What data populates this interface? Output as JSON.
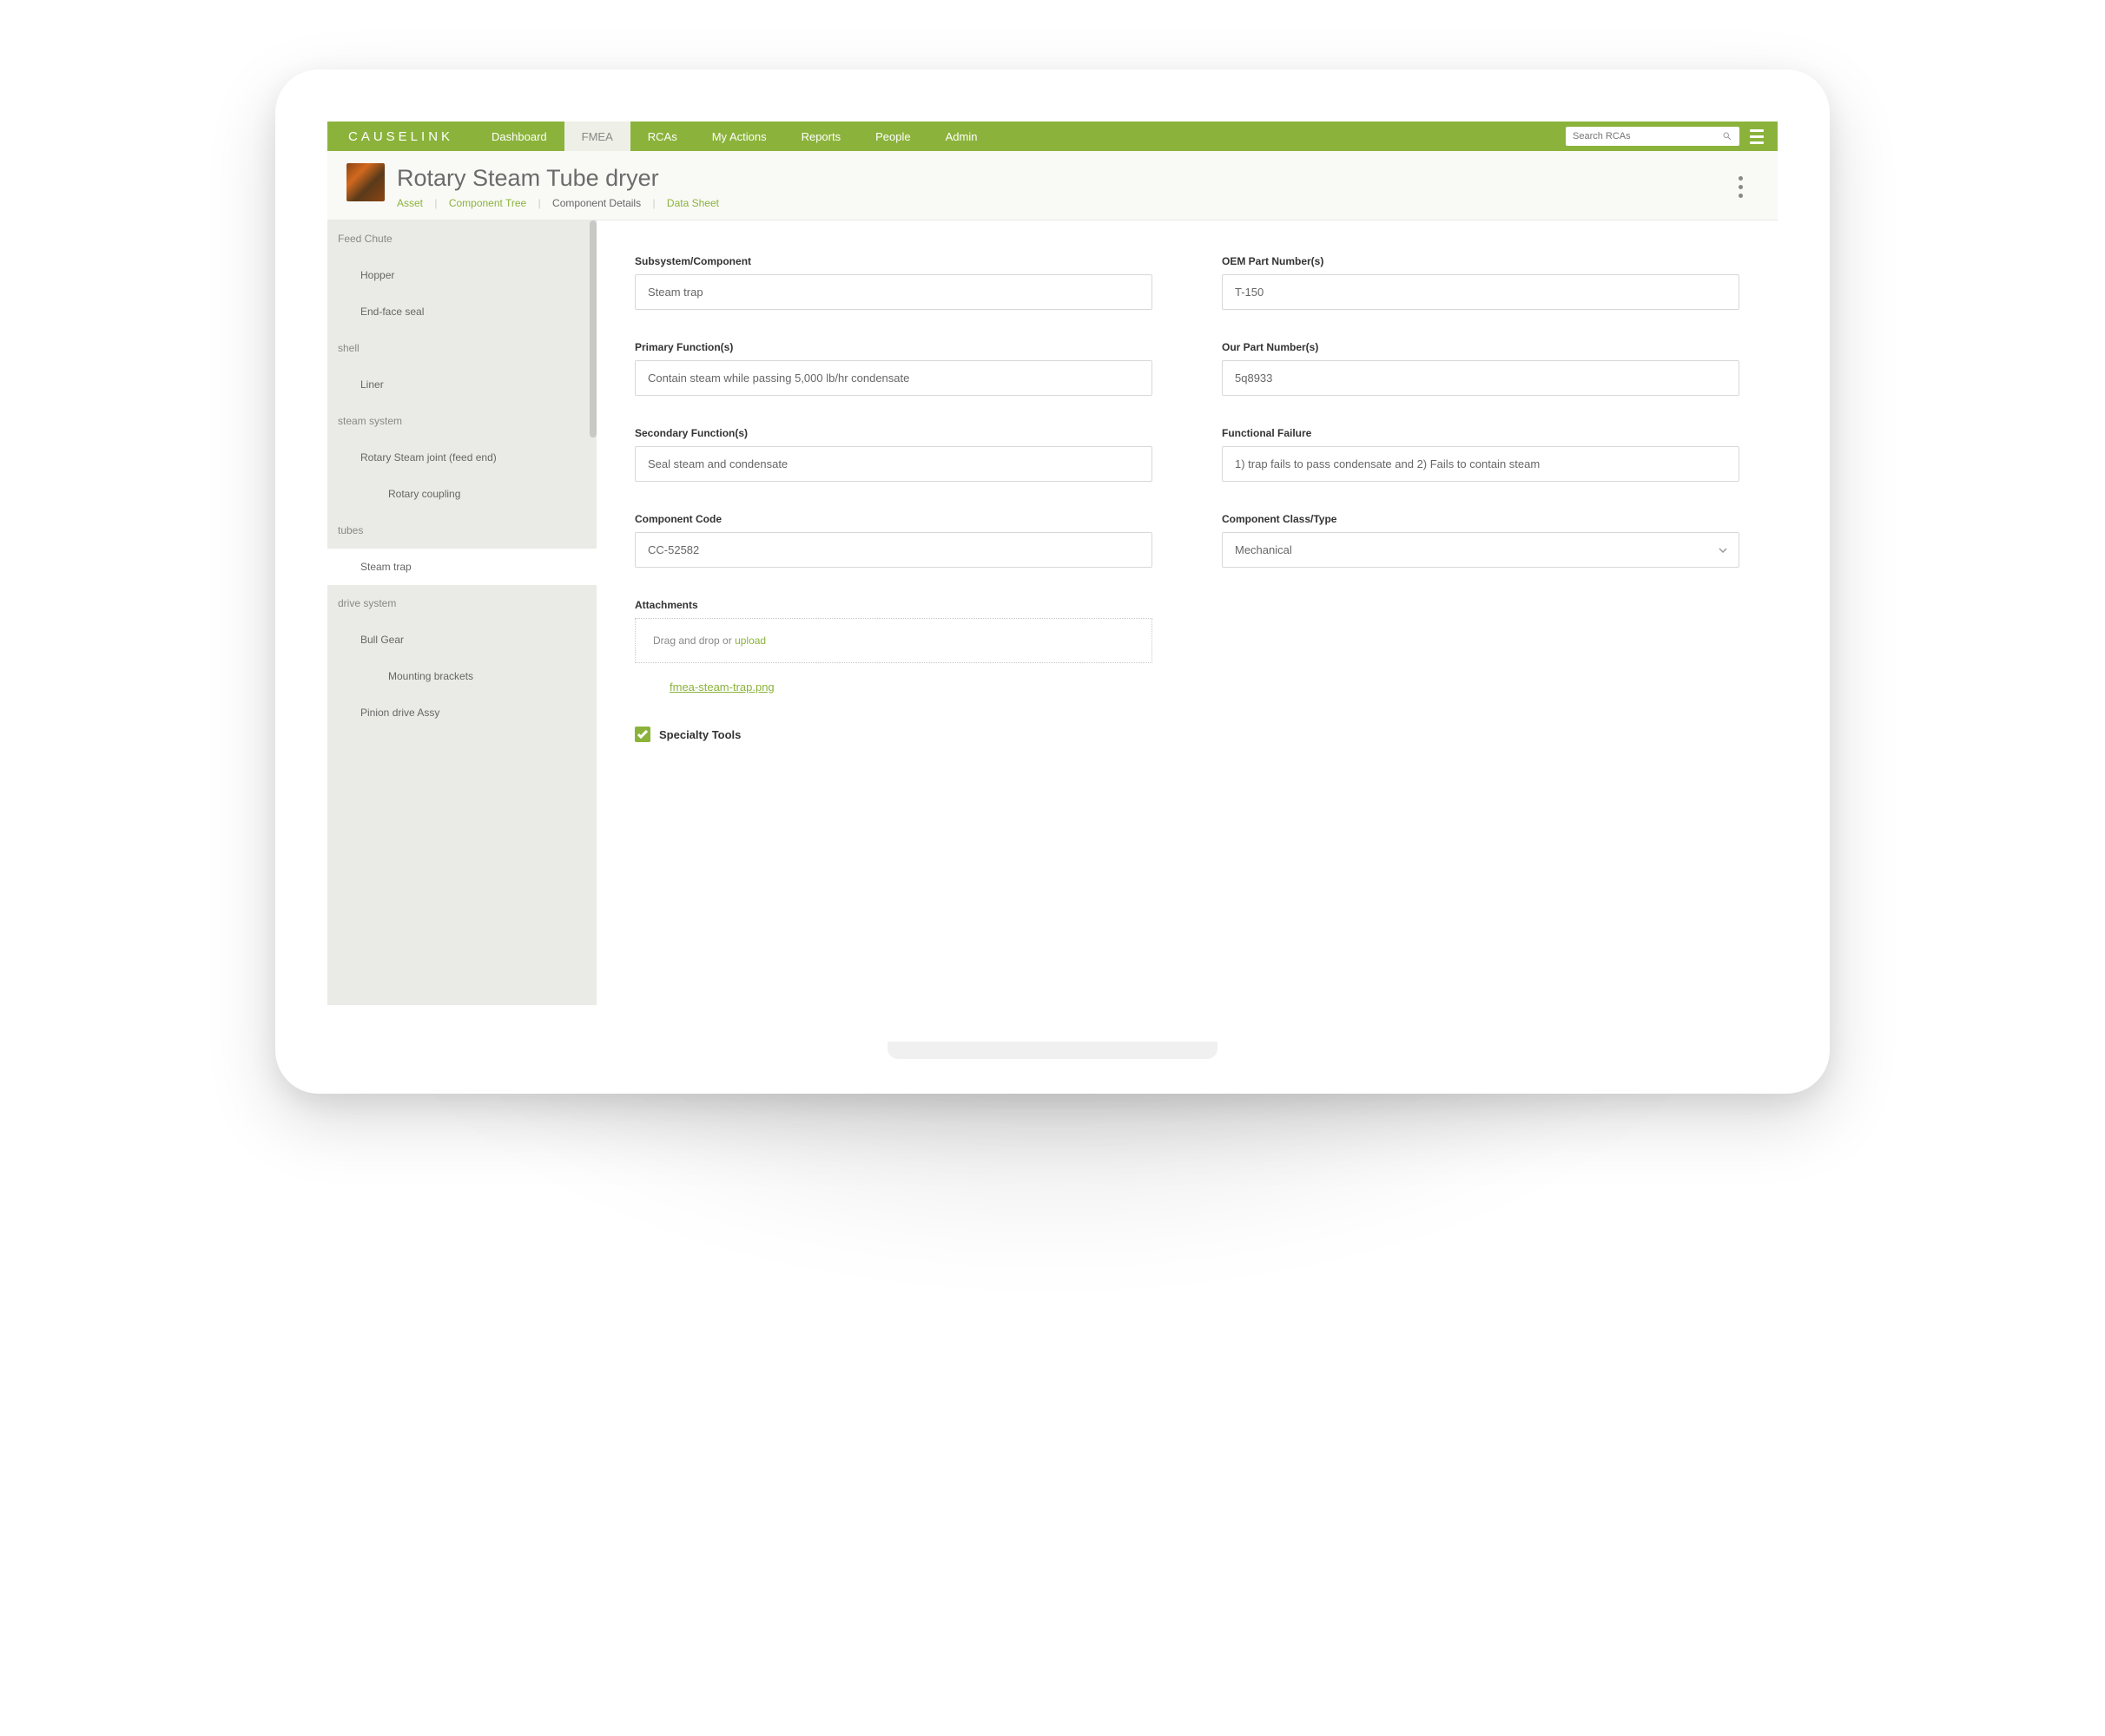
{
  "brand": "CAUSELINK",
  "nav": {
    "items": [
      "Dashboard",
      "FMEA",
      "RCAs",
      "My Actions",
      "Reports",
      "People",
      "Admin"
    ],
    "active_index": 1,
    "search_placeholder": "Search RCAs"
  },
  "header": {
    "title": "Rotary Steam Tube dryer",
    "breadcrumbs": {
      "asset": "Asset",
      "component_tree": "Component Tree",
      "component_details": "Component Details",
      "data_sheet": "Data Sheet"
    }
  },
  "sidebar": {
    "items": [
      {
        "label": "Feed Chute",
        "level": 0,
        "selected": false
      },
      {
        "label": "Hopper",
        "level": 1,
        "selected": false
      },
      {
        "label": "End-face seal",
        "level": 1,
        "selected": false
      },
      {
        "label": "shell",
        "level": 0,
        "selected": false
      },
      {
        "label": "Liner",
        "level": 1,
        "selected": false
      },
      {
        "label": "steam system",
        "level": 0,
        "selected": false
      },
      {
        "label": "Rotary Steam joint (feed end)",
        "level": 1,
        "selected": false
      },
      {
        "label": "Rotary coupling",
        "level": 2,
        "selected": false
      },
      {
        "label": "tubes",
        "level": 0,
        "selected": false
      },
      {
        "label": "Steam trap",
        "level": 1,
        "selected": true
      },
      {
        "label": "drive system",
        "level": 0,
        "selected": false
      },
      {
        "label": "Bull Gear",
        "level": 1,
        "selected": false
      },
      {
        "label": "Mounting brackets",
        "level": 2,
        "selected": false
      },
      {
        "label": "Pinion drive Assy",
        "level": 1,
        "selected": false
      }
    ]
  },
  "form": {
    "labels": {
      "subsystem": "Subsystem/Component",
      "oem_part": "OEM Part Number(s)",
      "primary_fn": "Primary Function(s)",
      "our_part": "Our Part Number(s)",
      "secondary_fn": "Secondary Function(s)",
      "functional_failure": "Functional Failure",
      "component_code": "Component Code",
      "component_class": "Component Class/Type",
      "attachments": "Attachments",
      "specialty_tools": "Specialty Tools"
    },
    "values": {
      "subsystem": "Steam trap",
      "oem_part": "T-150",
      "primary_fn": "Contain steam while passing 5,000 lb/hr condensate",
      "our_part": "5q8933",
      "secondary_fn": "Seal steam and condensate",
      "functional_failure": "1) trap fails to pass condensate and 2) Fails to contain steam",
      "component_code": "CC-52582",
      "component_class": "Mechanical"
    },
    "attachments": {
      "drop_text": "Drag and drop or ",
      "upload_text": "upload",
      "file": "fmea-steam-trap.png"
    }
  }
}
